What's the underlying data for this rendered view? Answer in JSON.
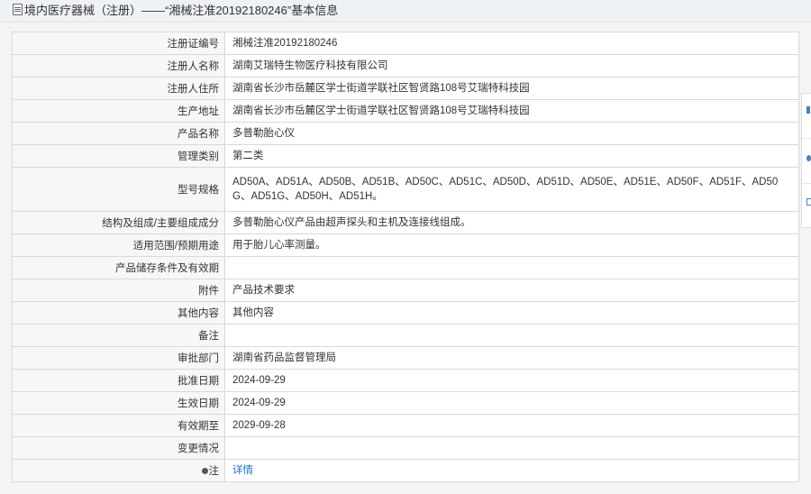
{
  "header": {
    "title": "境内医疗器械（注册）——“湘械注准20192180246”基本信息"
  },
  "rows": [
    {
      "label": "注册证编号",
      "value": "湘械注准20192180246"
    },
    {
      "label": "注册人名称",
      "value": "湖南艾瑞特生物医疗科技有限公司"
    },
    {
      "label": "注册人住所",
      "value": "湖南省长沙市岳麓区学士街道学联社区智贤路108号艾瑞特科技园"
    },
    {
      "label": "生产地址",
      "value": "湖南省长沙市岳麓区学士街道学联社区智贤路108号艾瑞特科技园"
    },
    {
      "label": "产品名称",
      "value": "多普勒胎心仪"
    },
    {
      "label": "管理类别",
      "value": "第二类"
    },
    {
      "label": "型号规格",
      "value": "AD50A、AD51A、AD50B、AD51B、AD50C、AD51C、AD50D、AD51D、AD50E、AD51E、AD50F、AD51F、AD50G、AD51G、AD50H、AD51H。"
    },
    {
      "label": "结构及组成/主要组成成分",
      "value": "多普勒胎心仪产品由超声探头和主机及连接线组成。"
    },
    {
      "label": "适用范围/预期用途",
      "value": "用于胎儿心率测量。"
    },
    {
      "label": "产品储存条件及有效期",
      "value": ""
    },
    {
      "label": "附件",
      "value": "产品技术要求"
    },
    {
      "label": "其他内容",
      "value": "其他内容"
    },
    {
      "label": "备注",
      "value": ""
    },
    {
      "label": "审批部门",
      "value": "湖南省药品监督管理局"
    },
    {
      "label": "批准日期",
      "value": "2024-09-29"
    },
    {
      "label": "生效日期",
      "value": "2024-09-29"
    },
    {
      "label": "有效期至",
      "value": "2029-09-28"
    },
    {
      "label": "变更情况",
      "value": ""
    }
  ],
  "note_row": {
    "label": "注",
    "link": "详情"
  }
}
